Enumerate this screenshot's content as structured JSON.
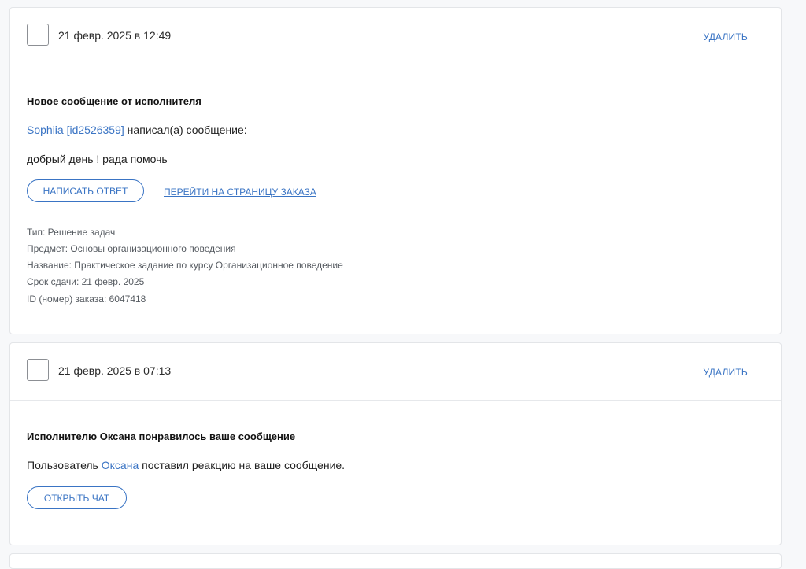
{
  "notifications": [
    {
      "date": "21 февр. 2025 в 12:49",
      "delete_label": "УДАЛИТЬ",
      "title": "Новое сообщение от исполнителя",
      "author_link": "Sophiia [id2526359]",
      "author_suffix": " написал(а) сообщение:",
      "message": "добрый день ! рада помочь",
      "reply_button": "НАПИСАТЬ ОТВЕТ",
      "order_link": "ПЕРЕЙТИ НА СТРАНИЦУ ЗАКАЗА",
      "meta": [
        "Тип: Решение задач",
        "Предмет: Основы организационного поведения",
        "Название: Практическое задание по курсу Организационное поведение",
        "Срок сдачи: 21 февр. 2025",
        "ID (номер) заказа: 6047418"
      ]
    },
    {
      "date": "21 февр. 2025 в 07:13",
      "delete_label": "УДАЛИТЬ",
      "title": "Исполнителю Оксана понравилось ваше сообщение",
      "text_prefix": "Пользователь ",
      "user_link": "Оксана",
      "text_suffix": " поставил реакцию на ваше сообщение.",
      "chat_button": "ОТКРЫТЬ ЧАТ"
    }
  ],
  "colors": {
    "accent": "#3a74c4",
    "border": "#e3e5e8",
    "background": "#f7f8fa"
  }
}
